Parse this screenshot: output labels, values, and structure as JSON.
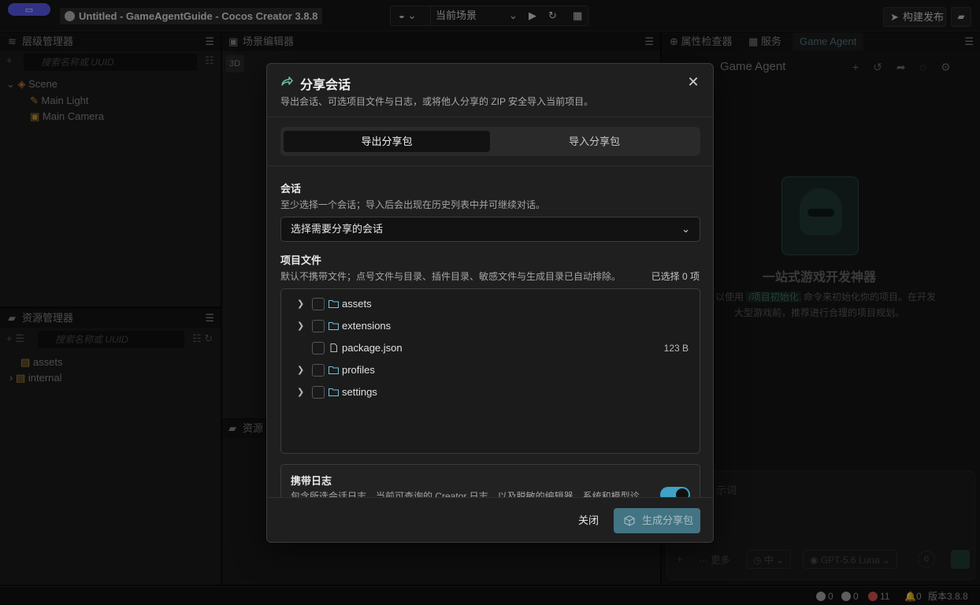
{
  "titlebar": {
    "app_badge": "▭",
    "window_title": "Untitled - GameAgentGuide - Cocos Creator 3.8.8",
    "scene_selector": "当前场景",
    "build_button": "构建发布"
  },
  "hierarchy": {
    "tab_label": "层级管理器",
    "search_placeholder": "搜索名称或 UUID",
    "items": [
      "Scene",
      "Main Light",
      "Main Camera"
    ]
  },
  "assets_panel": {
    "tab_label": "资源管理器",
    "search_placeholder": "搜索名称或 UUID",
    "items": [
      "assets",
      "internal"
    ]
  },
  "scene_panel": {
    "tab_label": "场景编辑器",
    "mode_3d": "3D",
    "bottom_tab": "资源"
  },
  "inspector": {
    "tabs": [
      "属性检查器",
      "服务",
      "Game Agent"
    ],
    "agent_title": "Game Agent",
    "hero_title": "一站式游戏开发神器",
    "hero_line1_a": "以使用",
    "hero_line1_link": "/项目初始化",
    "hero_line1_b": "命令来初始化你的项目。在开发",
    "hero_line2": "大型游戏前，推荐进行合理的项目规划。",
    "input_placeholder": "示词",
    "more": "更多",
    "level": "中",
    "model": "GPT-5.6 Luna",
    "counter": "0"
  },
  "statusbar": {
    "info": "0",
    "warn": "0",
    "errors": "11",
    "notify": "0",
    "version": "版本3.8.8"
  },
  "modal": {
    "title": "分享会话",
    "subtitle": "导出会话、可选项目文件与日志，或将他人分享的 ZIP 安全导入当前项目。",
    "tabs": [
      "导出分享包",
      "导入分享包"
    ],
    "session": {
      "title": "会话",
      "desc": "至少选择一个会话；导入后会出现在历史列表中并可继续对话。",
      "select_placeholder": "选择需要分享的会话"
    },
    "files": {
      "title": "项目文件",
      "desc": "默认不携带文件；点号文件与目录、插件目录、敏感文件与生成目录已自动排除。",
      "selected": "已选择 0 项",
      "rows": [
        {
          "name": "assets",
          "type": "folder",
          "size": ""
        },
        {
          "name": "extensions",
          "type": "folder",
          "size": ""
        },
        {
          "name": "package.json",
          "type": "file",
          "size": "123 B"
        },
        {
          "name": "profiles",
          "type": "folder",
          "size": ""
        },
        {
          "name": "settings",
          "type": "folder",
          "size": ""
        }
      ]
    },
    "logs": {
      "title": "携带日志",
      "desc": "包含所选会话日志、当前可查询的 Creator 日志，以及脱敏的编辑器、系统和模型诊",
      "enabled": true
    },
    "footer": {
      "close": "关闭",
      "generate": "生成分享包"
    }
  },
  "colors": {
    "accent": "#4c8a9c",
    "toggle_on": "#3ea3c7",
    "app_badge": "#5b5bf0",
    "error": "#d9534f"
  }
}
